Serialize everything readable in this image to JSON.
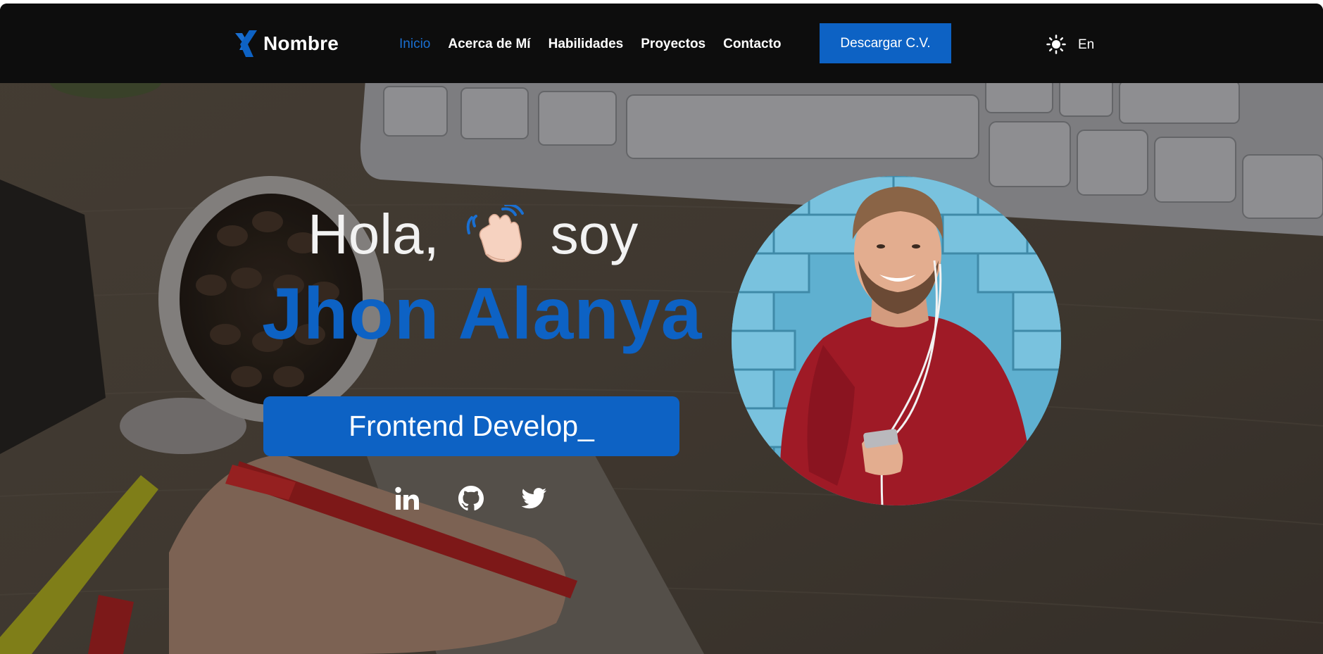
{
  "header": {
    "brand": {
      "logo_icon": "x-brand-logo-icon",
      "name": "Nombre"
    },
    "nav": [
      {
        "label": "Inicio",
        "active": true
      },
      {
        "label": "Acerca de Mí",
        "active": false
      },
      {
        "label": "Habilidades",
        "active": false
      },
      {
        "label": "Proyectos",
        "active": false
      },
      {
        "label": "Contacto",
        "active": false
      }
    ],
    "cv_button": "Descargar C.V.",
    "theme_icon": "sun-icon",
    "lang": "En"
  },
  "hero": {
    "greeting_before": "Hola,",
    "greeting_emoji": "waving-hand-icon",
    "greeting_after": "soy",
    "name": "Jhon Alanya",
    "role": "Frontend Develop_",
    "social": [
      {
        "icon": "linkedin-icon"
      },
      {
        "icon": "github-icon"
      },
      {
        "icon": "twitter-icon"
      }
    ],
    "avatar": "profile-photo"
  },
  "colors": {
    "accent": "#0d62c4",
    "header_bg": "#0d0d0d",
    "text_light": "#ffffff"
  }
}
